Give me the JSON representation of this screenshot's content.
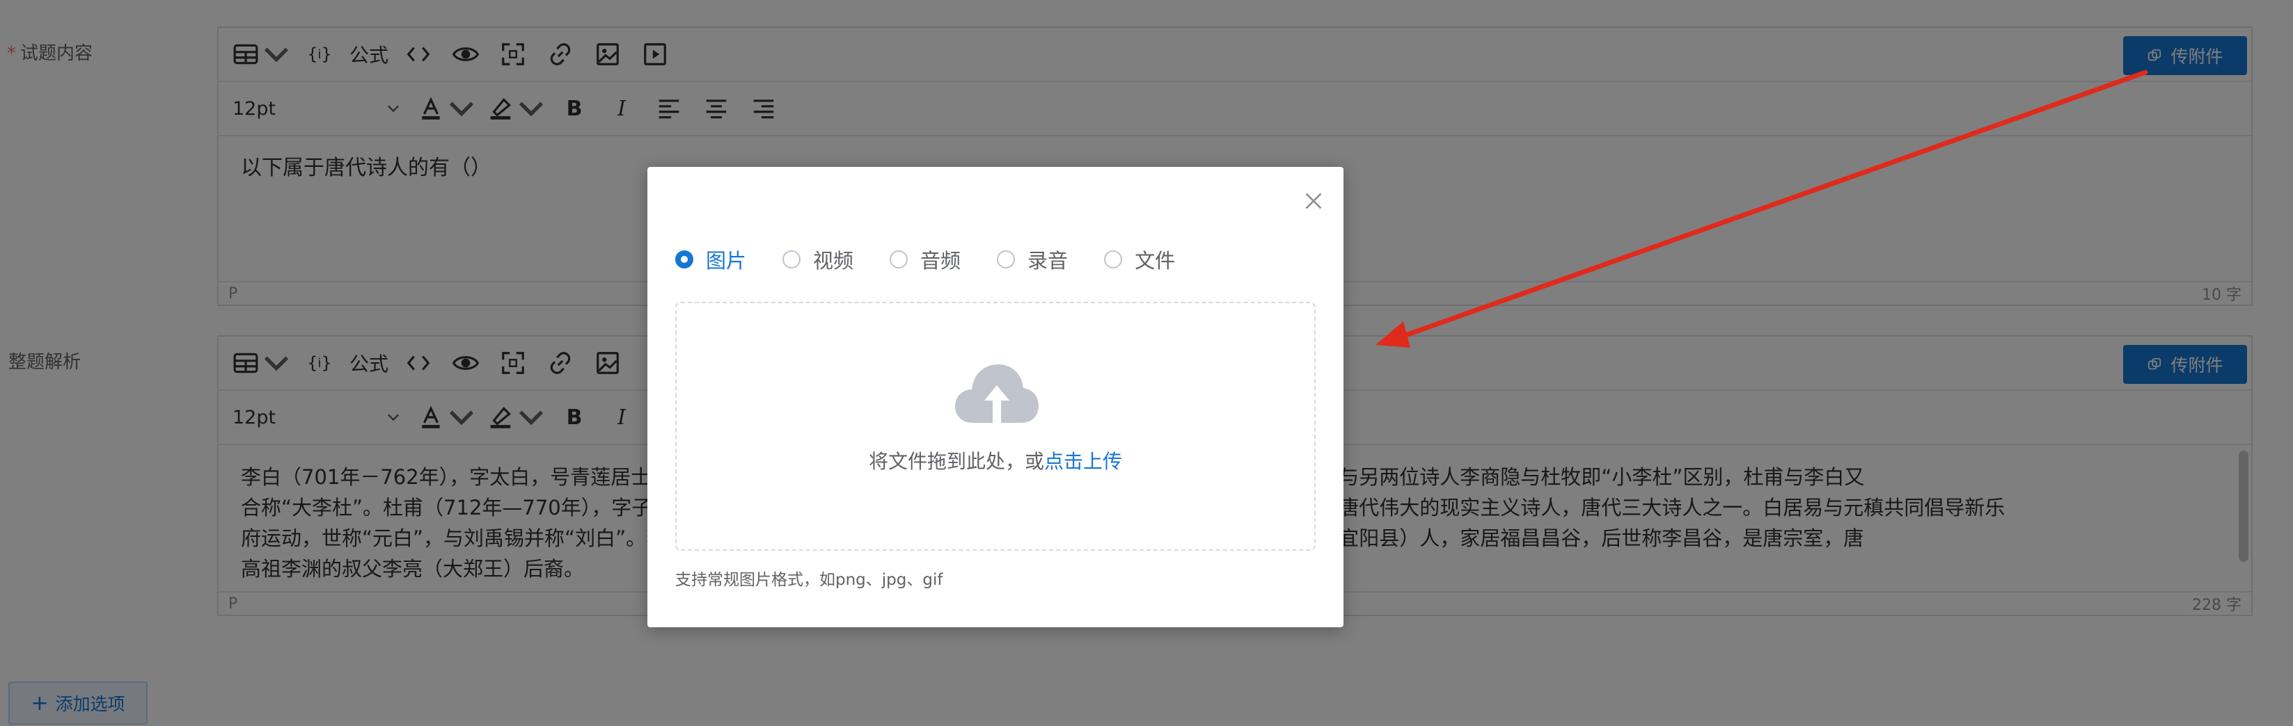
{
  "form": {
    "question_label": "试题内容",
    "question_required": "*",
    "analysis_label": "整题解析",
    "add_option": "添加选项"
  },
  "toolbar": {
    "formula": "公式",
    "font_size": "12pt",
    "attach": "传附件"
  },
  "question_editor": {
    "content": "以下属于唐代诗人的有（）",
    "status_tag": "P",
    "word_count": "10 字"
  },
  "analysis_editor": {
    "lines": [
      "李白（701年－762年），字太白，号青莲居士，唐代伟大的浪漫主义诗人，被后人誉为“诗仙”，与杜甫并称为“李杜”，为了与另两位诗人李商隐与杜牧即“小李杜”区别，杜甫与李白又",
      "合称“大李杜”。杜甫（712年—770年），字子美，自号少陵野老，唐代伟大的现实主义诗人，与李白合称“李杜”。白居易是唐代伟大的现实主义诗人，唐代三大诗人之一。白居易与元稹共同倡导新乐",
      "府运动，世称“元白”，与刘禹锡并称“刘白”。李贺（790年－816年），字长吉，唐代著名诗人，唐代河南福昌（今河南洛阳宜阳县）人，家居福昌昌谷，后世称李昌谷，是唐宗室，唐",
      "高祖李渊的叔父李亮（大郑王）后裔。"
    ],
    "status_tag": "P",
    "word_count": "228 字"
  },
  "dialog": {
    "radio_options": [
      {
        "label": "图片",
        "checked": true
      },
      {
        "label": "视频",
        "checked": false
      },
      {
        "label": "音频",
        "checked": false
      },
      {
        "label": "录音",
        "checked": false
      },
      {
        "label": "文件",
        "checked": false
      }
    ],
    "drop_text": "将文件拖到此处，或",
    "upload_link": "点击上传",
    "hint": "支持常规图片格式，如png、jpg、gif"
  },
  "colors": {
    "primary": "#1677d2",
    "arrow": "#e02a1c",
    "mask": "rgba(0,0,0,0.5)"
  }
}
